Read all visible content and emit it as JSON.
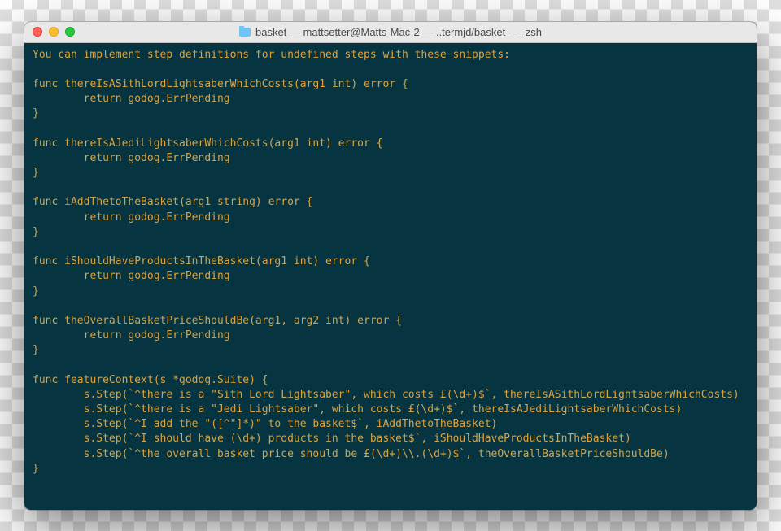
{
  "titlebar": {
    "title": "basket — mattsetter@Matts-Mac-2 — ..termjd/basket — -zsh"
  },
  "terminal": {
    "lines": [
      "You can implement step definitions for undefined steps with these snippets:",
      "",
      "func thereIsASithLordLightsaberWhichCosts(arg1 int) error {",
      "        return godog.ErrPending",
      "}",
      "",
      "func thereIsAJediLightsaberWhichCosts(arg1 int) error {",
      "        return godog.ErrPending",
      "}",
      "",
      "func iAddThetoTheBasket(arg1 string) error {",
      "        return godog.ErrPending",
      "}",
      "",
      "func iShouldHaveProductsInTheBasket(arg1 int) error {",
      "        return godog.ErrPending",
      "}",
      "",
      "func theOverallBasketPriceShouldBe(arg1, arg2 int) error {",
      "        return godog.ErrPending",
      "}",
      "",
      "func featureContext(s *godog.Suite) {",
      "        s.Step(`^there is a \"Sith Lord Lightsaber\", which costs £(\\d+)$`, thereIsASithLordLightsaberWhichCosts)",
      "        s.Step(`^there is a \"Jedi Lightsaber\", which costs £(\\d+)$`, thereIsAJediLightsaberWhichCosts)",
      "        s.Step(`^I add the \"([^\"]*)\" to the basket$`, iAddThetoTheBasket)",
      "        s.Step(`^I should have (\\d+) products in the basket$`, iShouldHaveProductsInTheBasket)",
      "        s.Step(`^the overall basket price should be £(\\d+)\\\\.(\\d+)$`, theOverallBasketPriceShouldBe)",
      "}"
    ]
  }
}
